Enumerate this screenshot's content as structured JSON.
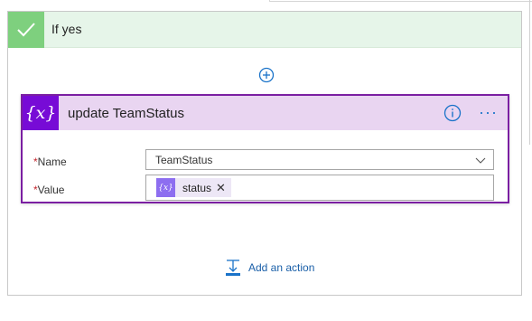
{
  "branch": {
    "title": "If yes"
  },
  "action_card": {
    "icon_text": "{x}",
    "title": "update TeamStatus",
    "more_label": "···",
    "fields": {
      "name": {
        "required_mark": "*",
        "label": "Name",
        "value": "TeamStatus"
      },
      "value": {
        "required_mark": "*",
        "label": "Value",
        "token_icon_text": "{x}",
        "token_label": "status",
        "token_remove": "✕"
      }
    }
  },
  "footer": {
    "add_action_label": "Add an action"
  },
  "colors": {
    "branch_header_bg": "#e6f5e9",
    "branch_check_bg": "#7ed07e",
    "card_border": "#7b1fa2",
    "card_header_bg": "#e9d5f1",
    "card_icon_bg": "#770bd6",
    "token_icon_bg": "#8d6ef0",
    "accent_blue": "#1a73c9"
  },
  "icons": {
    "branch": "checkmark-icon",
    "insert": "add-step-icon",
    "info": "info-icon",
    "more": "more-icon",
    "dropdown": "chevron-down-icon",
    "add_action": "add-action-icon"
  }
}
